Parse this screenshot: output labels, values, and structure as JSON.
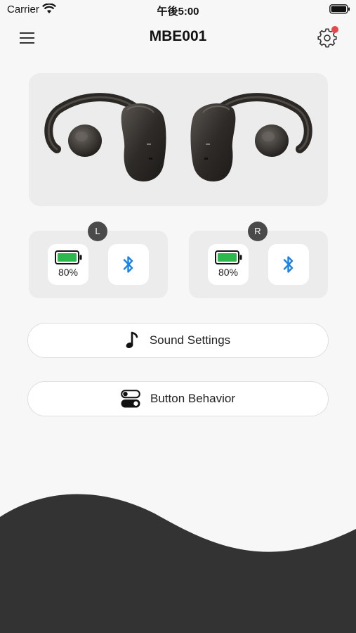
{
  "status_bar": {
    "carrier": "Carrier",
    "time": "午後5:00"
  },
  "header": {
    "title": "MBE001",
    "settings_has_notification": true
  },
  "earbuds": {
    "left": {
      "badge": "L",
      "battery": "80%",
      "battery_level": 0.8,
      "bluetooth_icon": "bluetooth-icon"
    },
    "right": {
      "badge": "R",
      "battery": "80%",
      "battery_level": 0.8,
      "bluetooth_icon": "bluetooth-icon"
    }
  },
  "actions": {
    "sound_settings": "Sound Settings",
    "button_behavior": "Button Behavior"
  },
  "colors": {
    "battery_fill": "#2db84d",
    "bluetooth": "#1a84e6",
    "notification": "#e8484c",
    "wave": "#333333"
  }
}
